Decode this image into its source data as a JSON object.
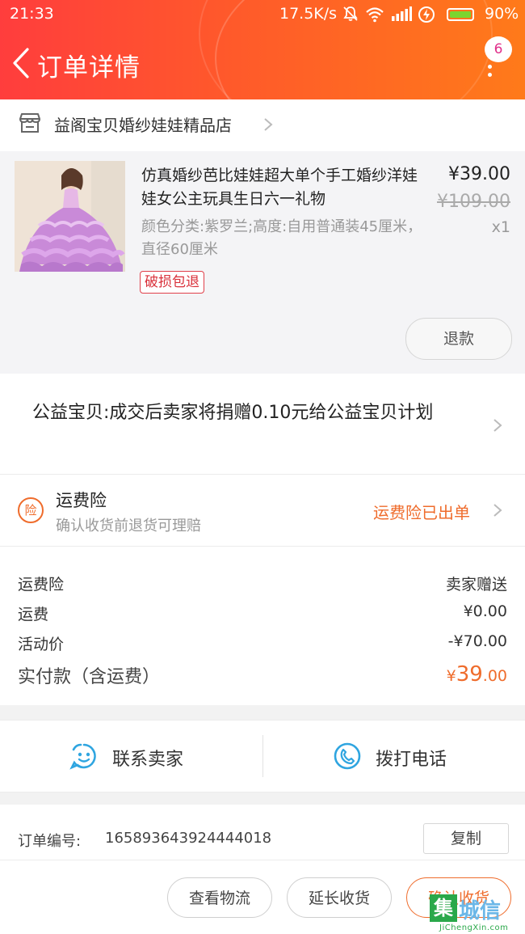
{
  "status_bar": {
    "time": "21:33",
    "net_speed": "17.5K/s",
    "battery_pct": "90%",
    "battery_level": 0.9
  },
  "header": {
    "title": "订单详情",
    "message_count": "6"
  },
  "shop": {
    "name": "益阁宝贝婚纱娃娃精品店"
  },
  "product": {
    "title": "仿真婚纱芭比娃娃超大单个手工婚纱洋娃娃女公主玩具生日六一礼物",
    "sku": "颜色分类:紫罗兰;高度:自用普通装45厘米，直径60厘米",
    "tag": "破损包退",
    "price": "¥39.00",
    "original_price": "¥109.00",
    "quantity": "x1",
    "refund_label": "退款"
  },
  "charity": {
    "text": "公益宝贝:成交后卖家将捐赠0.10元给公益宝贝计划"
  },
  "insurance": {
    "icon_char": "险",
    "title": "运费险",
    "subtitle": "确认收货前退货可理赔",
    "status": "运费险已出单"
  },
  "fees": {
    "rows": [
      {
        "label": "运费险",
        "value": "卖家赠送"
      },
      {
        "label": "运费",
        "value": "¥0.00"
      },
      {
        "label": "活动价",
        "value": "-¥70.00"
      }
    ],
    "total_label": "实付款（含运费）",
    "total_currency": "¥",
    "total_int": "39",
    "total_dec": ".00"
  },
  "contact": {
    "seller_label": "联系卖家",
    "call_label": "拨打电话"
  },
  "order": {
    "number_label": "订单编号:",
    "number": "165893643924444018",
    "copy_label": "复制"
  },
  "footer": {
    "logistics_label": "查看物流",
    "extend_label": "延长收货",
    "confirm_label": "确认收货"
  },
  "watermark": {
    "mark": "集",
    "text": "城信",
    "url": "JiChengXin.com"
  },
  "colors": {
    "accent": "#ef6c2c",
    "header_start": "#ff3d3d",
    "header_end": "#ff7a1a",
    "tag_red": "#d9303a"
  }
}
